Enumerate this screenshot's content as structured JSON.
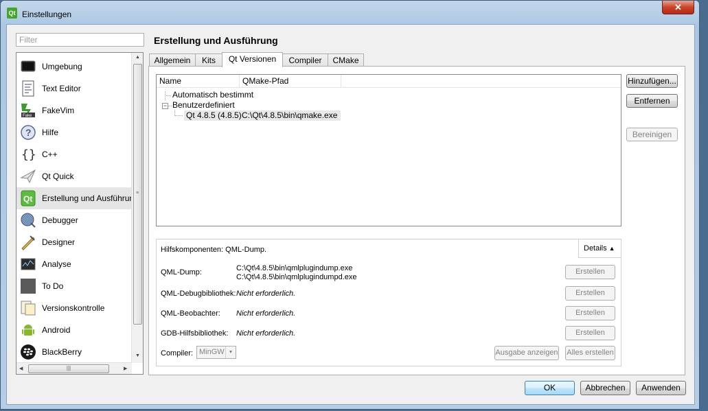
{
  "window": {
    "title": "Einstellungen",
    "app_icon": "Qt",
    "close_label": "✕"
  },
  "filter": {
    "placeholder": "Filter"
  },
  "sidebar": {
    "items": [
      {
        "label": "Umgebung",
        "icon": "monitor-icon"
      },
      {
        "label": "Text Editor",
        "icon": "text-editor-icon"
      },
      {
        "label": "FakeVim",
        "icon": "fakevim-icon"
      },
      {
        "label": "Hilfe",
        "icon": "help-icon"
      },
      {
        "label": "C++",
        "icon": "braces-icon"
      },
      {
        "label": "Qt Quick",
        "icon": "paper-plane-icon"
      },
      {
        "label": "Erstellung und Ausführung",
        "icon": "build-run-icon",
        "selected": true
      },
      {
        "label": "Debugger",
        "icon": "debugger-icon"
      },
      {
        "label": "Designer",
        "icon": "designer-icon"
      },
      {
        "label": "Analyse",
        "icon": "analyze-icon"
      },
      {
        "label": "To Do",
        "icon": "todo-icon"
      },
      {
        "label": "Versionskontrolle",
        "icon": "version-control-icon"
      },
      {
        "label": "Android",
        "icon": "android-icon"
      },
      {
        "label": "BlackBerry",
        "icon": "blackberry-icon"
      }
    ]
  },
  "page": {
    "title": "Erstellung und Ausführung",
    "tabs": [
      "Allgemein",
      "Kits",
      "Qt Versionen",
      "Compiler",
      "CMake"
    ],
    "active_tab": "Qt Versionen"
  },
  "versions_table": {
    "columns": [
      "Name",
      "QMake-Pfad"
    ],
    "groups": [
      {
        "label": "Automatisch bestimmt",
        "expanded": false,
        "rows": []
      },
      {
        "label": "Benutzerdefiniert",
        "expanded": true,
        "rows": [
          {
            "name": "Qt 4.8.5 (4.8.5)",
            "path": "C:\\Qt\\4.8.5\\bin\\qmake.exe"
          }
        ]
      }
    ]
  },
  "side_buttons": {
    "add": "Hinzufügen...",
    "remove": "Entfernen",
    "clean": "Bereinigen"
  },
  "details": {
    "summary": "Hilfskomponenten: QML-Dump.",
    "toggle": "Details",
    "rows": [
      {
        "label": "QML-Dump:",
        "value_line1": "C:\\Qt\\4.8.5\\bin\\qmlplugindump.exe",
        "value_line2": "C:\\Qt\\4.8.5\\bin\\qmlplugindumpd.exe",
        "button": "Erstellen"
      },
      {
        "label": "QML-Debugbibliothek:",
        "value": "Nicht erforderlich.",
        "button": "Erstellen"
      },
      {
        "label": "QML-Beobachter:",
        "value": "Nicht erforderlich.",
        "button": "Erstellen"
      },
      {
        "label": "GDB-Hilfsbibliothek:",
        "value": "Nicht erforderlich.",
        "button": "Erstellen"
      }
    ],
    "compiler_label": "Compiler:",
    "compiler_value": "MinGW",
    "show_output": "Ausgabe anzeigen",
    "build_all": "Alles erstellen"
  },
  "dialog_buttons": {
    "ok": "OK",
    "cancel": "Abbrechen",
    "apply": "Anwenden"
  },
  "colors": {
    "titlebar": "#b5cde6",
    "close": "#c9452a",
    "selection": "#e5e5e5",
    "default_button": "#bee6fd"
  }
}
